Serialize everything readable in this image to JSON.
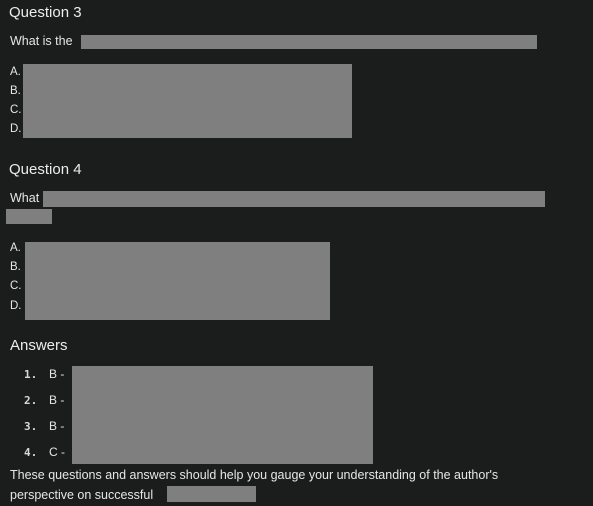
{
  "q3": {
    "heading": "Question 3",
    "prompt": "What is the",
    "options": [
      "A.",
      "B.",
      "C.",
      "D."
    ]
  },
  "q4": {
    "heading": "Question 4",
    "prompt": "What",
    "options": [
      "A.",
      "B.",
      "C.",
      "D."
    ]
  },
  "answers": {
    "heading": "Answers",
    "items": [
      {
        "num": "1.",
        "letter": "B -"
      },
      {
        "num": "2.",
        "letter": "B -"
      },
      {
        "num": "3.",
        "letter": "B -"
      },
      {
        "num": "4.",
        "letter": "C -"
      }
    ]
  },
  "footer": {
    "line1": "These questions and answers should help you gauge your understanding of the author's",
    "line2": "perspective on successful"
  },
  "colors": {
    "background": "#1b1c1c",
    "redaction": "#7f7f7f",
    "text": "#e6e6e6"
  }
}
